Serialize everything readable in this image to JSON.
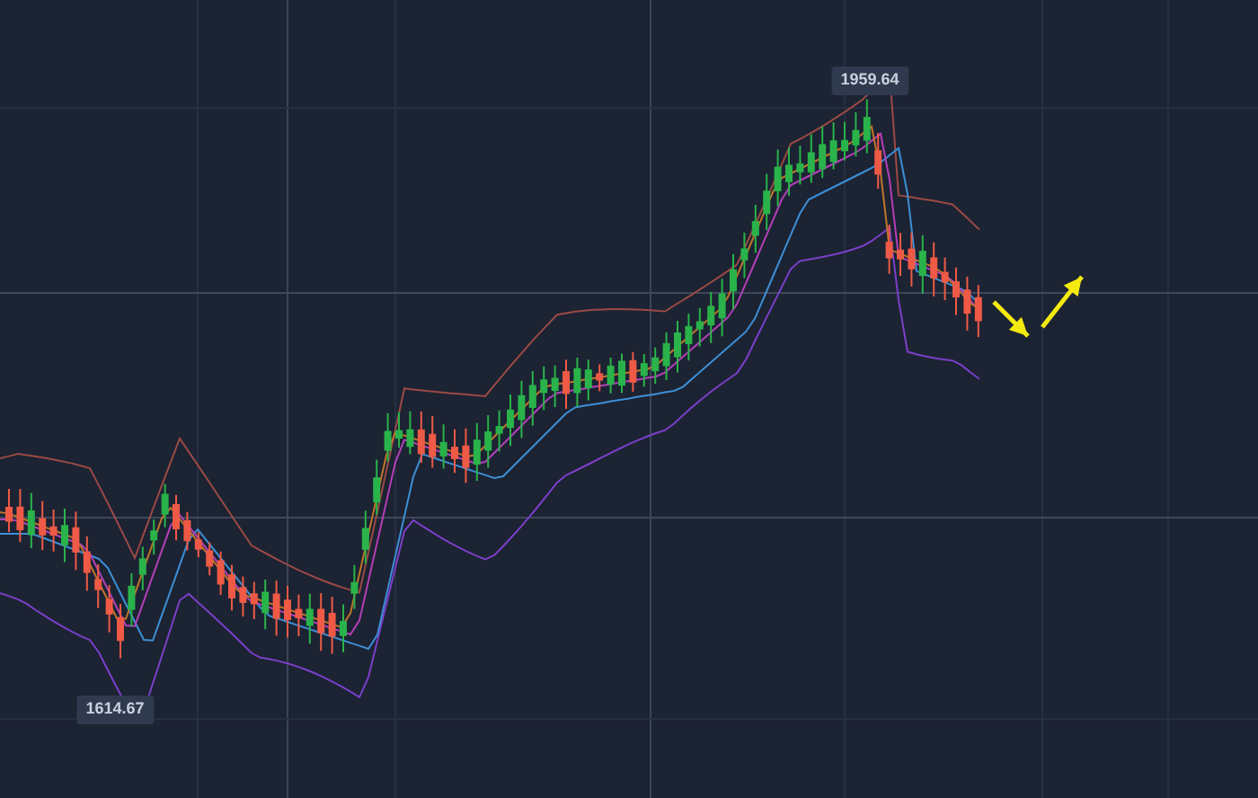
{
  "chart": {
    "high_label": "1959.64",
    "low_label": "1614.67"
  }
}
